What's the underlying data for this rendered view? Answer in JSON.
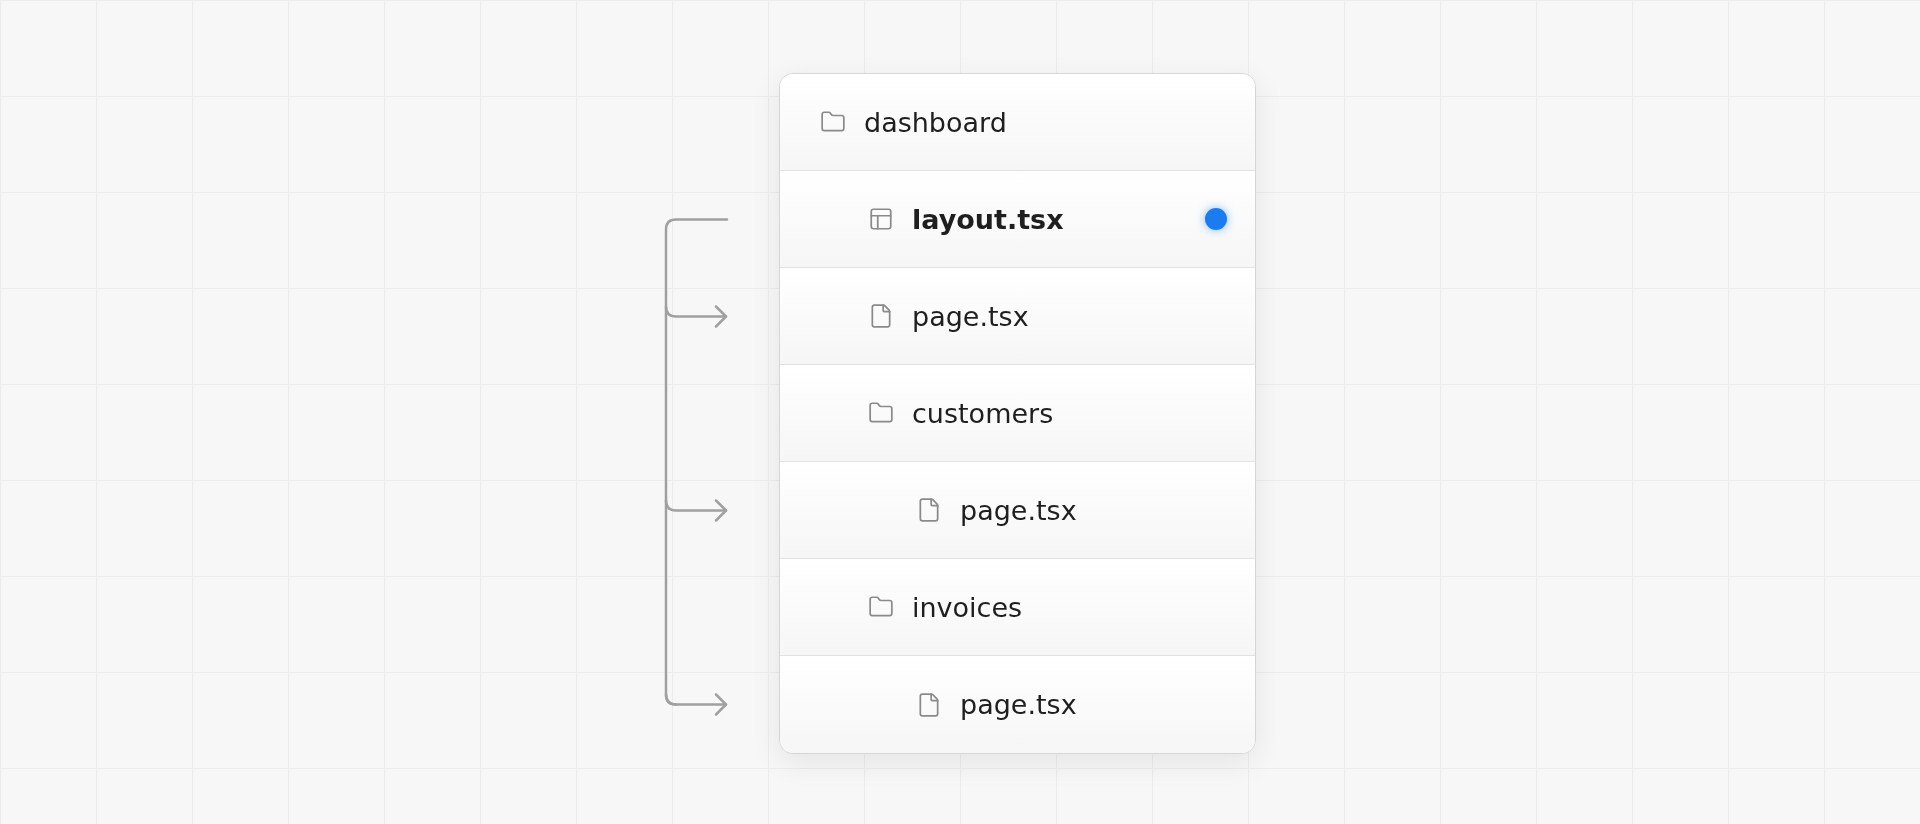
{
  "tree": [
    {
      "name": "dashboard",
      "kind": "folder",
      "highlighted": false,
      "children": [
        {
          "name": "layout.tsx",
          "kind": "layout",
          "highlighted": true
        },
        {
          "name": "page.tsx",
          "kind": "page",
          "highlighted": false
        },
        {
          "name": "customers",
          "kind": "folder",
          "highlighted": false,
          "children": [
            {
              "name": "page.tsx",
              "kind": "page",
              "highlighted": false
            }
          ]
        },
        {
          "name": "invoices",
          "kind": "folder",
          "highlighted": false,
          "children": [
            {
              "name": "page.tsx",
              "kind": "page",
              "highlighted": false
            }
          ]
        }
      ]
    }
  ]
}
